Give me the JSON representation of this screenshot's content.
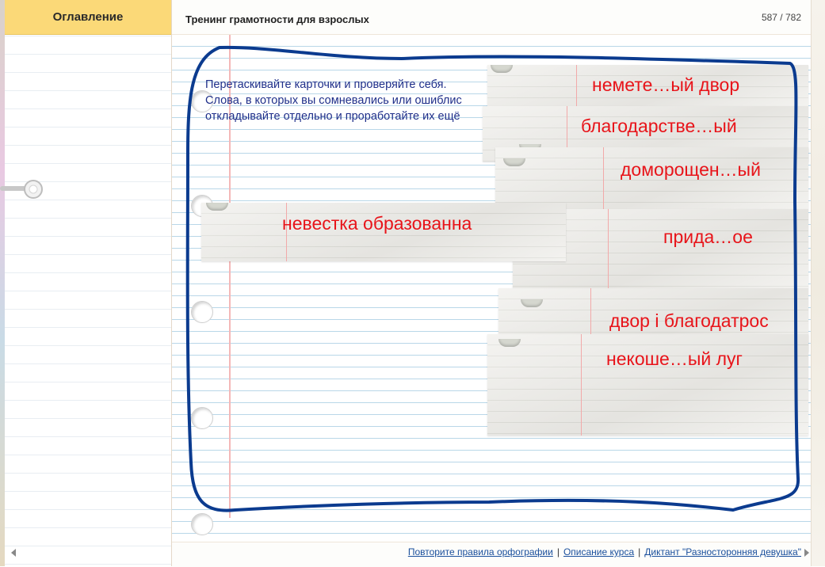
{
  "sidebar": {
    "header_label": "Оглавление"
  },
  "header": {
    "course_title": "Тренинг грамотности для взрослых",
    "page_counter": "587 / 782"
  },
  "instructions": {
    "line1": "Перетаскивайте карточки и проверяйте себя.",
    "line2": "Слова, в которых вы сомневались или ошиблис",
    "line3": "откладывайте отдельно и проработайте их ещё"
  },
  "cards": [
    {
      "word": "немете…ый двор"
    },
    {
      "word": "благодарстве…ый"
    },
    {
      "word": "доморощен…ый"
    },
    {
      "word": "невестка образованна"
    },
    {
      "word": "прида…ое"
    },
    {
      "word": "двор і благодатрос"
    },
    {
      "word": "некоше…ый луг"
    }
  ],
  "footer": {
    "links": [
      "Повторите правила орфографии",
      "Описание курса",
      "Диктант \"Разносторонняя девушка\""
    ],
    "separator": "|"
  },
  "colors": {
    "card_word": "#e8141a",
    "outline": "#0b3b8f",
    "sidebar_header": "#fbd978",
    "instructions": "#1f2f8a"
  }
}
